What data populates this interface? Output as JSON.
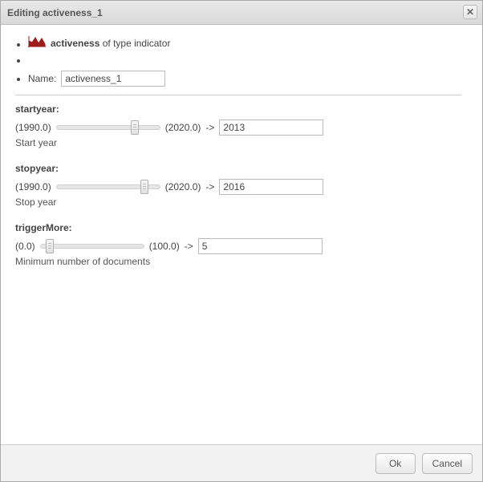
{
  "dialog": {
    "title": "Editing activeness_1"
  },
  "header": {
    "name_bold": "activeness",
    "name_suffix": " of type indicator"
  },
  "nameField": {
    "label": "Name: ",
    "value": "activeness_1"
  },
  "params": {
    "startyear": {
      "label": "startyear:",
      "min_text": "(1990.0)",
      "max_text": "(2020.0)",
      "arrow": "->",
      "value": "2013",
      "desc": "Start year",
      "min": 1990,
      "max": 2020,
      "current": 2013
    },
    "stopyear": {
      "label": "stopyear:",
      "min_text": "(1990.0)",
      "max_text": "(2020.0)",
      "arrow": "->",
      "value": "2016",
      "desc": "Stop year",
      "min": 1990,
      "max": 2020,
      "current": 2016
    },
    "triggerMore": {
      "label": "triggerMore:",
      "min_text": "(0.0)",
      "max_text": "(100.0)",
      "arrow": "->",
      "value": "5",
      "desc": "Minimum number of documents",
      "min": 0,
      "max": 100,
      "current": 5
    }
  },
  "footer": {
    "ok": "Ok",
    "cancel": "Cancel"
  },
  "colors": {
    "accent": "#9e1b1b"
  }
}
